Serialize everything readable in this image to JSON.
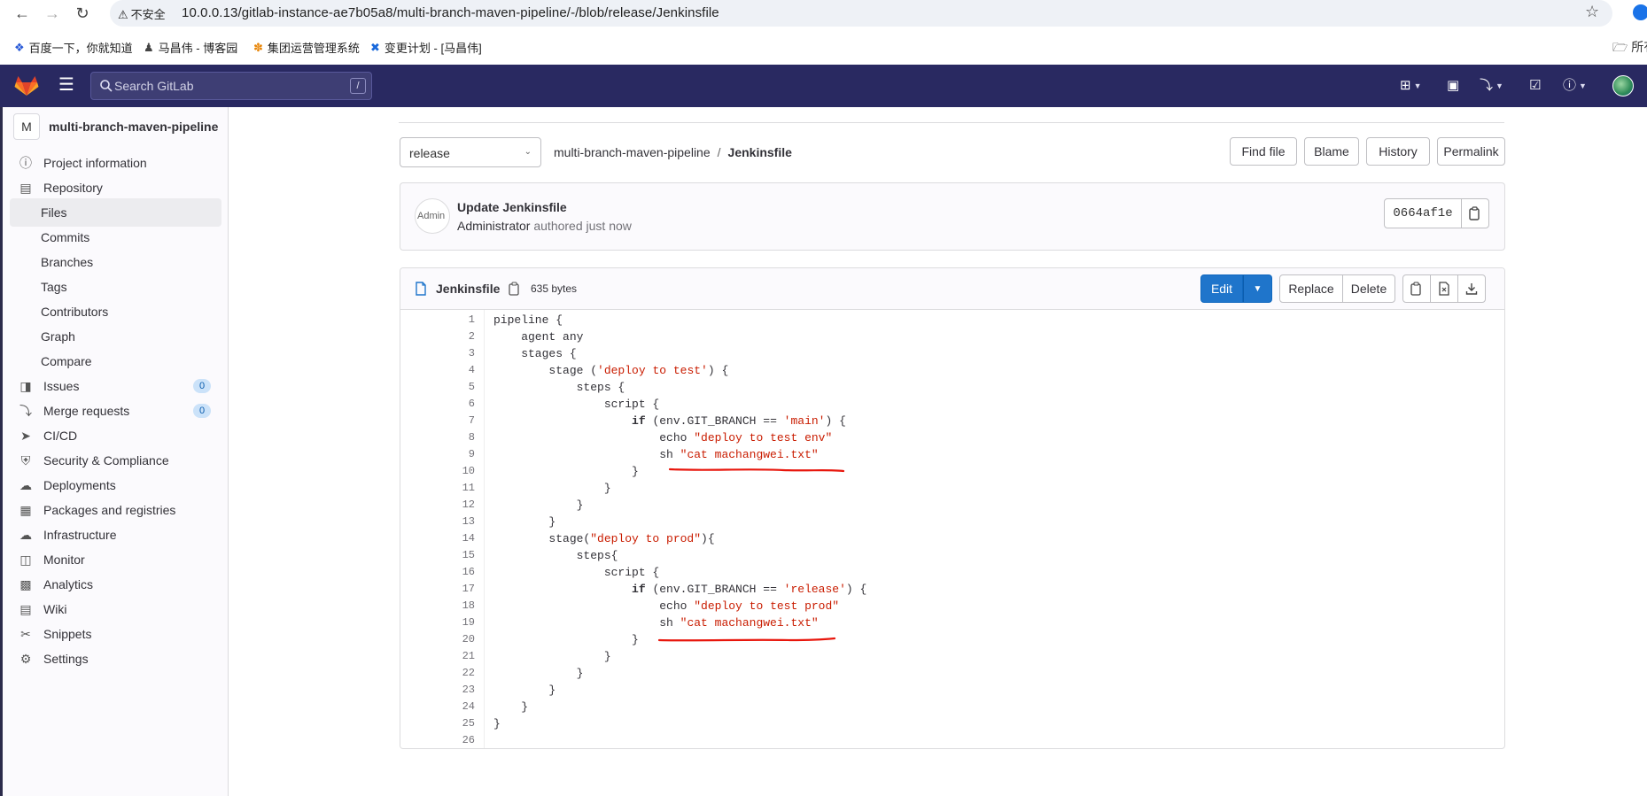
{
  "browser": {
    "insecure_label": "不安全",
    "url": "10.0.0.13/gitlab-instance-ae7b05a8/multi-branch-maven-pipeline/-/blob/release/Jenkinsfile",
    "bookmarks": [
      {
        "label": "百度一下，你就知道",
        "icon": "baidu-icon"
      },
      {
        "label": "马昌伟 - 博客园",
        "icon": "cnblogs-icon"
      },
      {
        "label": "集团运营管理系统",
        "icon": "ops-icon"
      },
      {
        "label": "变更计划 - [马昌伟]",
        "icon": "confluence-icon"
      }
    ],
    "bookmark_folder": "所有"
  },
  "topbar": {
    "search_placeholder": "Search GitLab",
    "search_shortcut": "/"
  },
  "sidebar": {
    "project_initial": "M",
    "project_name": "multi-branch-maven-pipeline",
    "items": [
      {
        "label": "Project information",
        "icon": "info-icon"
      },
      {
        "label": "Repository",
        "icon": "doc-icon"
      },
      {
        "label": "Files",
        "sub": true,
        "active": true
      },
      {
        "label": "Commits",
        "sub": true
      },
      {
        "label": "Branches",
        "sub": true
      },
      {
        "label": "Tags",
        "sub": true
      },
      {
        "label": "Contributors",
        "sub": true
      },
      {
        "label": "Graph",
        "sub": true
      },
      {
        "label": "Compare",
        "sub": true
      },
      {
        "label": "Issues",
        "icon": "issues-icon",
        "badge": "0"
      },
      {
        "label": "Merge requests",
        "icon": "merge-request-icon",
        "badge": "0"
      },
      {
        "label": "CI/CD",
        "icon": "rocket-icon"
      },
      {
        "label": "Security & Compliance",
        "icon": "shield-icon"
      },
      {
        "label": "Deployments",
        "icon": "deployments-icon"
      },
      {
        "label": "Packages and registries",
        "icon": "package-icon"
      },
      {
        "label": "Infrastructure",
        "icon": "cloud-icon"
      },
      {
        "label": "Monitor",
        "icon": "monitor-icon"
      },
      {
        "label": "Analytics",
        "icon": "chart-icon"
      },
      {
        "label": "Wiki",
        "icon": "book-icon"
      },
      {
        "label": "Snippets",
        "icon": "scissors-icon"
      },
      {
        "label": "Settings",
        "icon": "gear-icon"
      }
    ]
  },
  "repo": {
    "branch": "release",
    "breadcrumb_project": "multi-branch-maven-pipeline",
    "breadcrumb_sep": "/",
    "breadcrumb_file": "Jenkinsfile",
    "buttons": {
      "find_file": "Find file",
      "blame": "Blame",
      "history": "History",
      "permalink": "Permalink"
    }
  },
  "commit": {
    "title": "Update Jenkinsfile",
    "author": "Administrator",
    "meta": "authored just now",
    "avatar_alt": "Admin",
    "sha": "0664af1e"
  },
  "file": {
    "name": "Jenkinsfile",
    "size": "635 bytes",
    "edit_label": "Edit",
    "replace_label": "Replace",
    "delete_label": "Delete"
  },
  "code_lines": [
    "pipeline {",
    "    agent any",
    "    stages {",
    "        stage ('deploy to test') {",
    "            steps {",
    "                script {",
    "                    if (env.GIT_BRANCH == 'main') {",
    "                        echo \"deploy to test env\"",
    "                        sh \"cat machangwei.txt\"",
    "                    }",
    "                }",
    "            }",
    "        }",
    "        stage(\"deploy to prod\"){",
    "            steps{",
    "                script {",
    "                    if (env.GIT_BRANCH == 'release') {",
    "                        echo \"deploy to test prod\"",
    "                        sh \"cat machangwei.txt\"",
    "                    }",
    "                }",
    "            }",
    "        }",
    "    }",
    "}",
    ""
  ],
  "colors": {
    "topbar": "#292961",
    "edit_button": "#1f75cb",
    "string": "#c91c00",
    "annotation_mark": "#e8160c"
  }
}
